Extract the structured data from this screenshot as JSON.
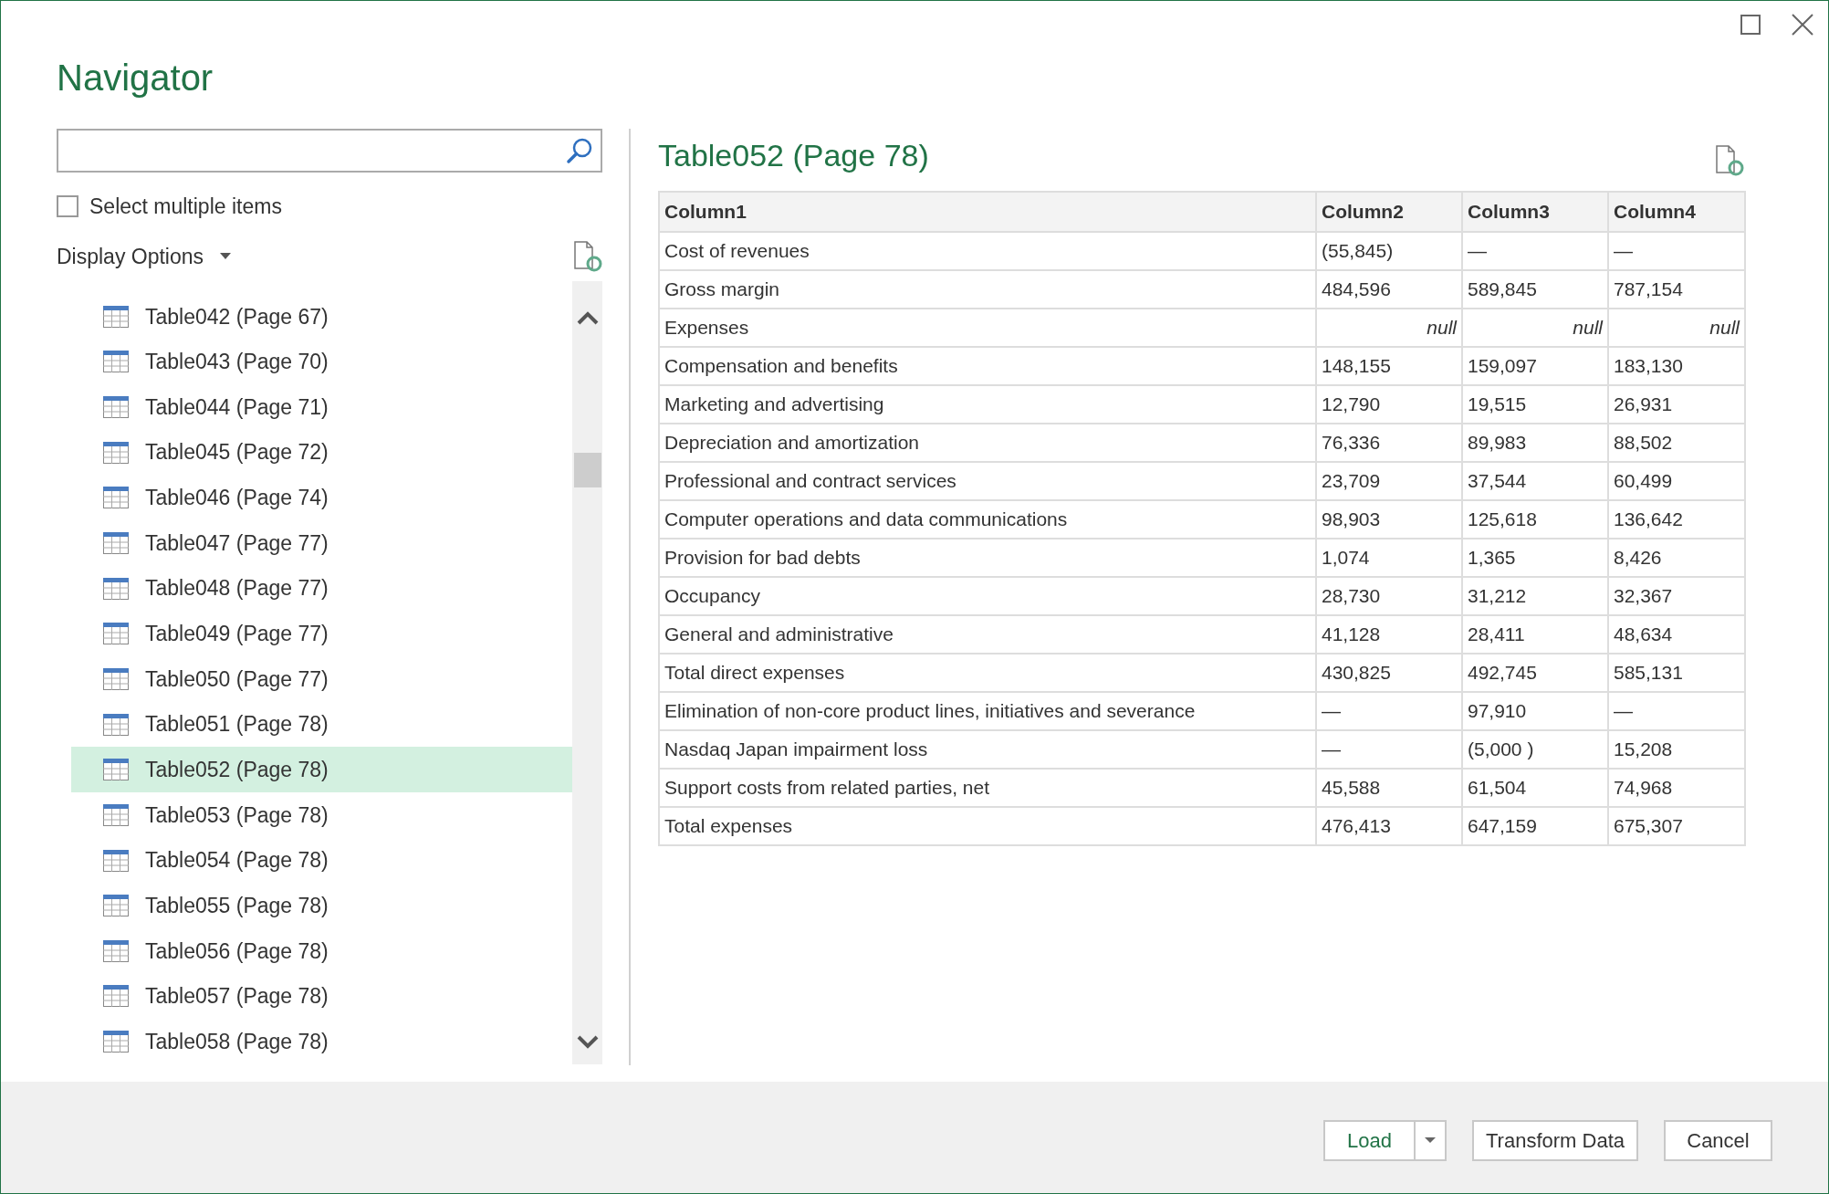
{
  "window": {
    "title": "Navigator"
  },
  "select_multiple": {
    "label": "Select multiple items",
    "checked": false
  },
  "display_options": {
    "label": "Display Options"
  },
  "items": [
    {
      "label": "Table042 (Page 67)",
      "selected": false
    },
    {
      "label": "Table043 (Page 70)",
      "selected": false
    },
    {
      "label": "Table044 (Page 71)",
      "selected": false
    },
    {
      "label": "Table045 (Page 72)",
      "selected": false
    },
    {
      "label": "Table046 (Page 74)",
      "selected": false
    },
    {
      "label": "Table047 (Page 77)",
      "selected": false
    },
    {
      "label": "Table048 (Page 77)",
      "selected": false
    },
    {
      "label": "Table049 (Page 77)",
      "selected": false
    },
    {
      "label": "Table050 (Page 77)",
      "selected": false
    },
    {
      "label": "Table051 (Page 78)",
      "selected": false
    },
    {
      "label": "Table052 (Page 78)",
      "selected": true
    },
    {
      "label": "Table053 (Page 78)",
      "selected": false
    },
    {
      "label": "Table054 (Page 78)",
      "selected": false
    },
    {
      "label": "Table055 (Page 78)",
      "selected": false
    },
    {
      "label": "Table056 (Page 78)",
      "selected": false
    },
    {
      "label": "Table057 (Page 78)",
      "selected": false
    },
    {
      "label": "Table058 (Page 78)",
      "selected": false
    }
  ],
  "preview": {
    "title": "Table052 (Page 78)",
    "columns": [
      "Column1",
      "Column2",
      "Column3",
      "Column4"
    ],
    "rows": [
      {
        "kind": "data",
        "cells": [
          "Cost of revenues",
          "(55,845)",
          "—",
          "—"
        ]
      },
      {
        "kind": "data",
        "cells": [
          "Gross margin",
          "484,596",
          "589,845",
          "787,154"
        ]
      },
      {
        "kind": "null",
        "cells": [
          "Expenses",
          "null",
          "null",
          "null"
        ]
      },
      {
        "kind": "data",
        "cells": [
          "Compensation and benefits",
          "148,155",
          "159,097",
          "183,130"
        ]
      },
      {
        "kind": "data",
        "cells": [
          "Marketing and advertising",
          "12,790",
          "19,515",
          "26,931"
        ]
      },
      {
        "kind": "data",
        "cells": [
          "Depreciation and amortization",
          "76,336",
          "89,983",
          "88,502"
        ]
      },
      {
        "kind": "data",
        "cells": [
          "Professional and contract services",
          "23,709",
          "37,544",
          "60,499"
        ]
      },
      {
        "kind": "data",
        "cells": [
          "Computer operations and data communications",
          "98,903",
          "125,618",
          "136,642"
        ]
      },
      {
        "kind": "data",
        "cells": [
          "Provision for bad debts",
          "1,074",
          "1,365",
          "8,426"
        ]
      },
      {
        "kind": "data",
        "cells": [
          "Occupancy",
          "28,730",
          "31,212",
          "32,367"
        ]
      },
      {
        "kind": "data",
        "cells": [
          "General and administrative",
          "41,128",
          "28,411",
          "48,634"
        ]
      },
      {
        "kind": "data",
        "cells": [
          "Total direct expenses",
          "430,825",
          "492,745",
          "585,131"
        ]
      },
      {
        "kind": "data",
        "cells": [
          "Elimination of non-core product lines, initiatives and severance",
          "—",
          "97,910",
          "—"
        ]
      },
      {
        "kind": "data",
        "cells": [
          "Nasdaq Japan impairment loss",
          "—",
          "(5,000 )",
          "15,208"
        ]
      },
      {
        "kind": "data",
        "cells": [
          "Support costs from related parties, net",
          "45,588",
          "61,504",
          "74,968"
        ]
      },
      {
        "kind": "data",
        "cells": [
          "Total expenses",
          "476,413",
          "647,159",
          "675,307"
        ]
      }
    ]
  },
  "buttons": {
    "load": "Load",
    "transform": "Transform Data",
    "cancel": "Cancel"
  }
}
